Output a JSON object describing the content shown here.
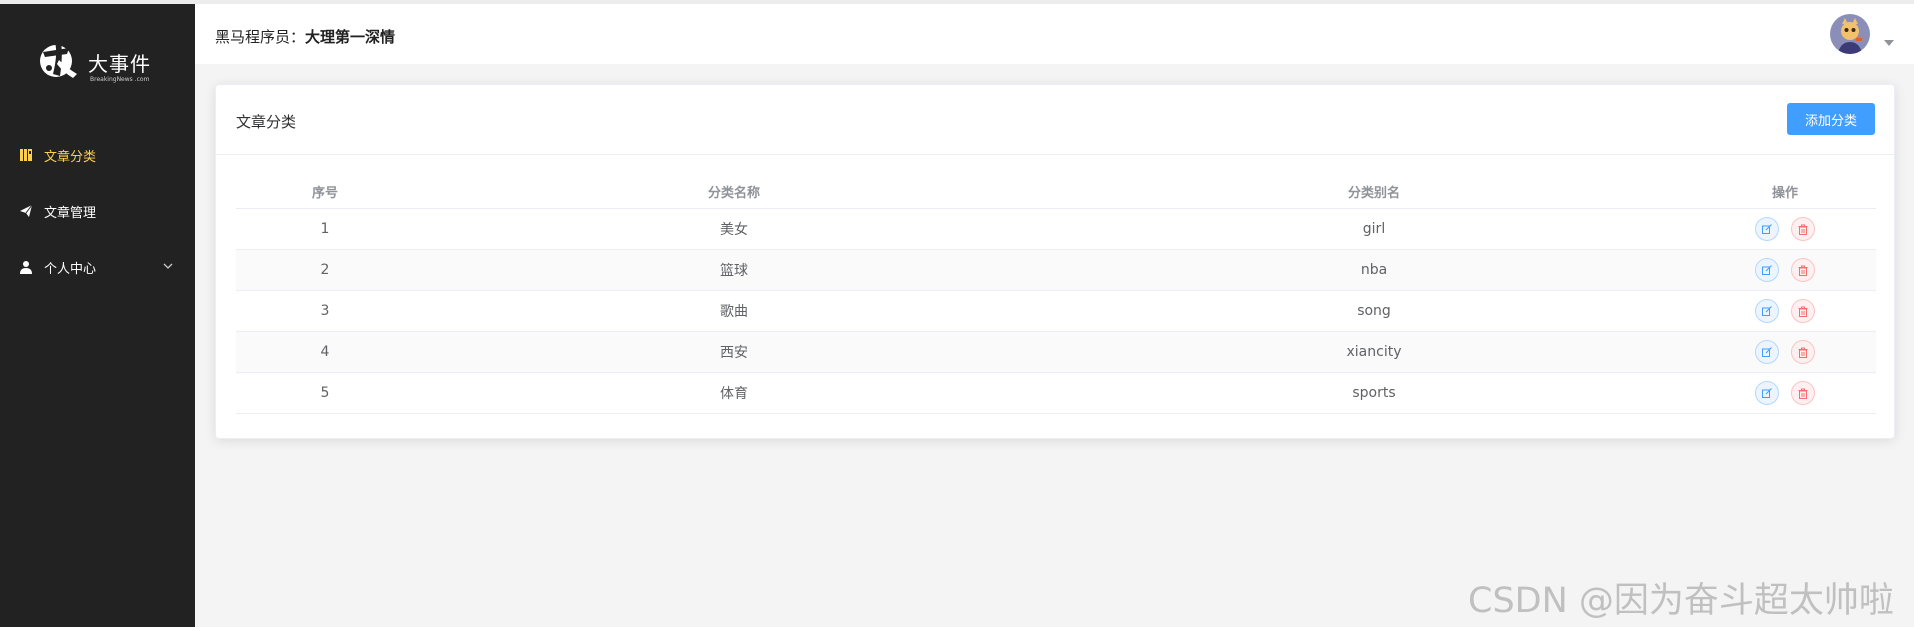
{
  "sidebar": {
    "logo": {
      "title": "大事件",
      "subtitle": "BreakingNews .com"
    },
    "menu": [
      {
        "label": "文章分类",
        "icon": "book-icon",
        "active": true
      },
      {
        "label": "文章管理",
        "icon": "send-icon",
        "active": false
      },
      {
        "label": "个人中心",
        "icon": "user-icon",
        "active": false,
        "expandable": true
      }
    ]
  },
  "header": {
    "welcome_prefix": "黑马程序员：",
    "username": "大理第一深情",
    "avatar_icon": "user-avatar",
    "dropdown_icon": "caret-down-icon"
  },
  "card": {
    "title": "文章分类",
    "add_button": "添加分类"
  },
  "table": {
    "columns": [
      "序号",
      "分类名称",
      "分类别名",
      "操作"
    ],
    "rows": [
      {
        "index": "1",
        "name": "美女",
        "alias": "girl"
      },
      {
        "index": "2",
        "name": "篮球",
        "alias": "nba"
      },
      {
        "index": "3",
        "name": "歌曲",
        "alias": "song"
      },
      {
        "index": "4",
        "name": "西安",
        "alias": "xiancity"
      },
      {
        "index": "5",
        "name": "体育",
        "alias": "sports"
      }
    ],
    "row_actions": [
      "edit-icon",
      "delete-icon"
    ]
  },
  "watermark": "CSDN @因为奋斗超太帅啦",
  "colors": {
    "sidebar_bg": "#222222",
    "active_menu": "#ffd04b",
    "primary": "#409eff",
    "danger": "#f56c6c"
  }
}
